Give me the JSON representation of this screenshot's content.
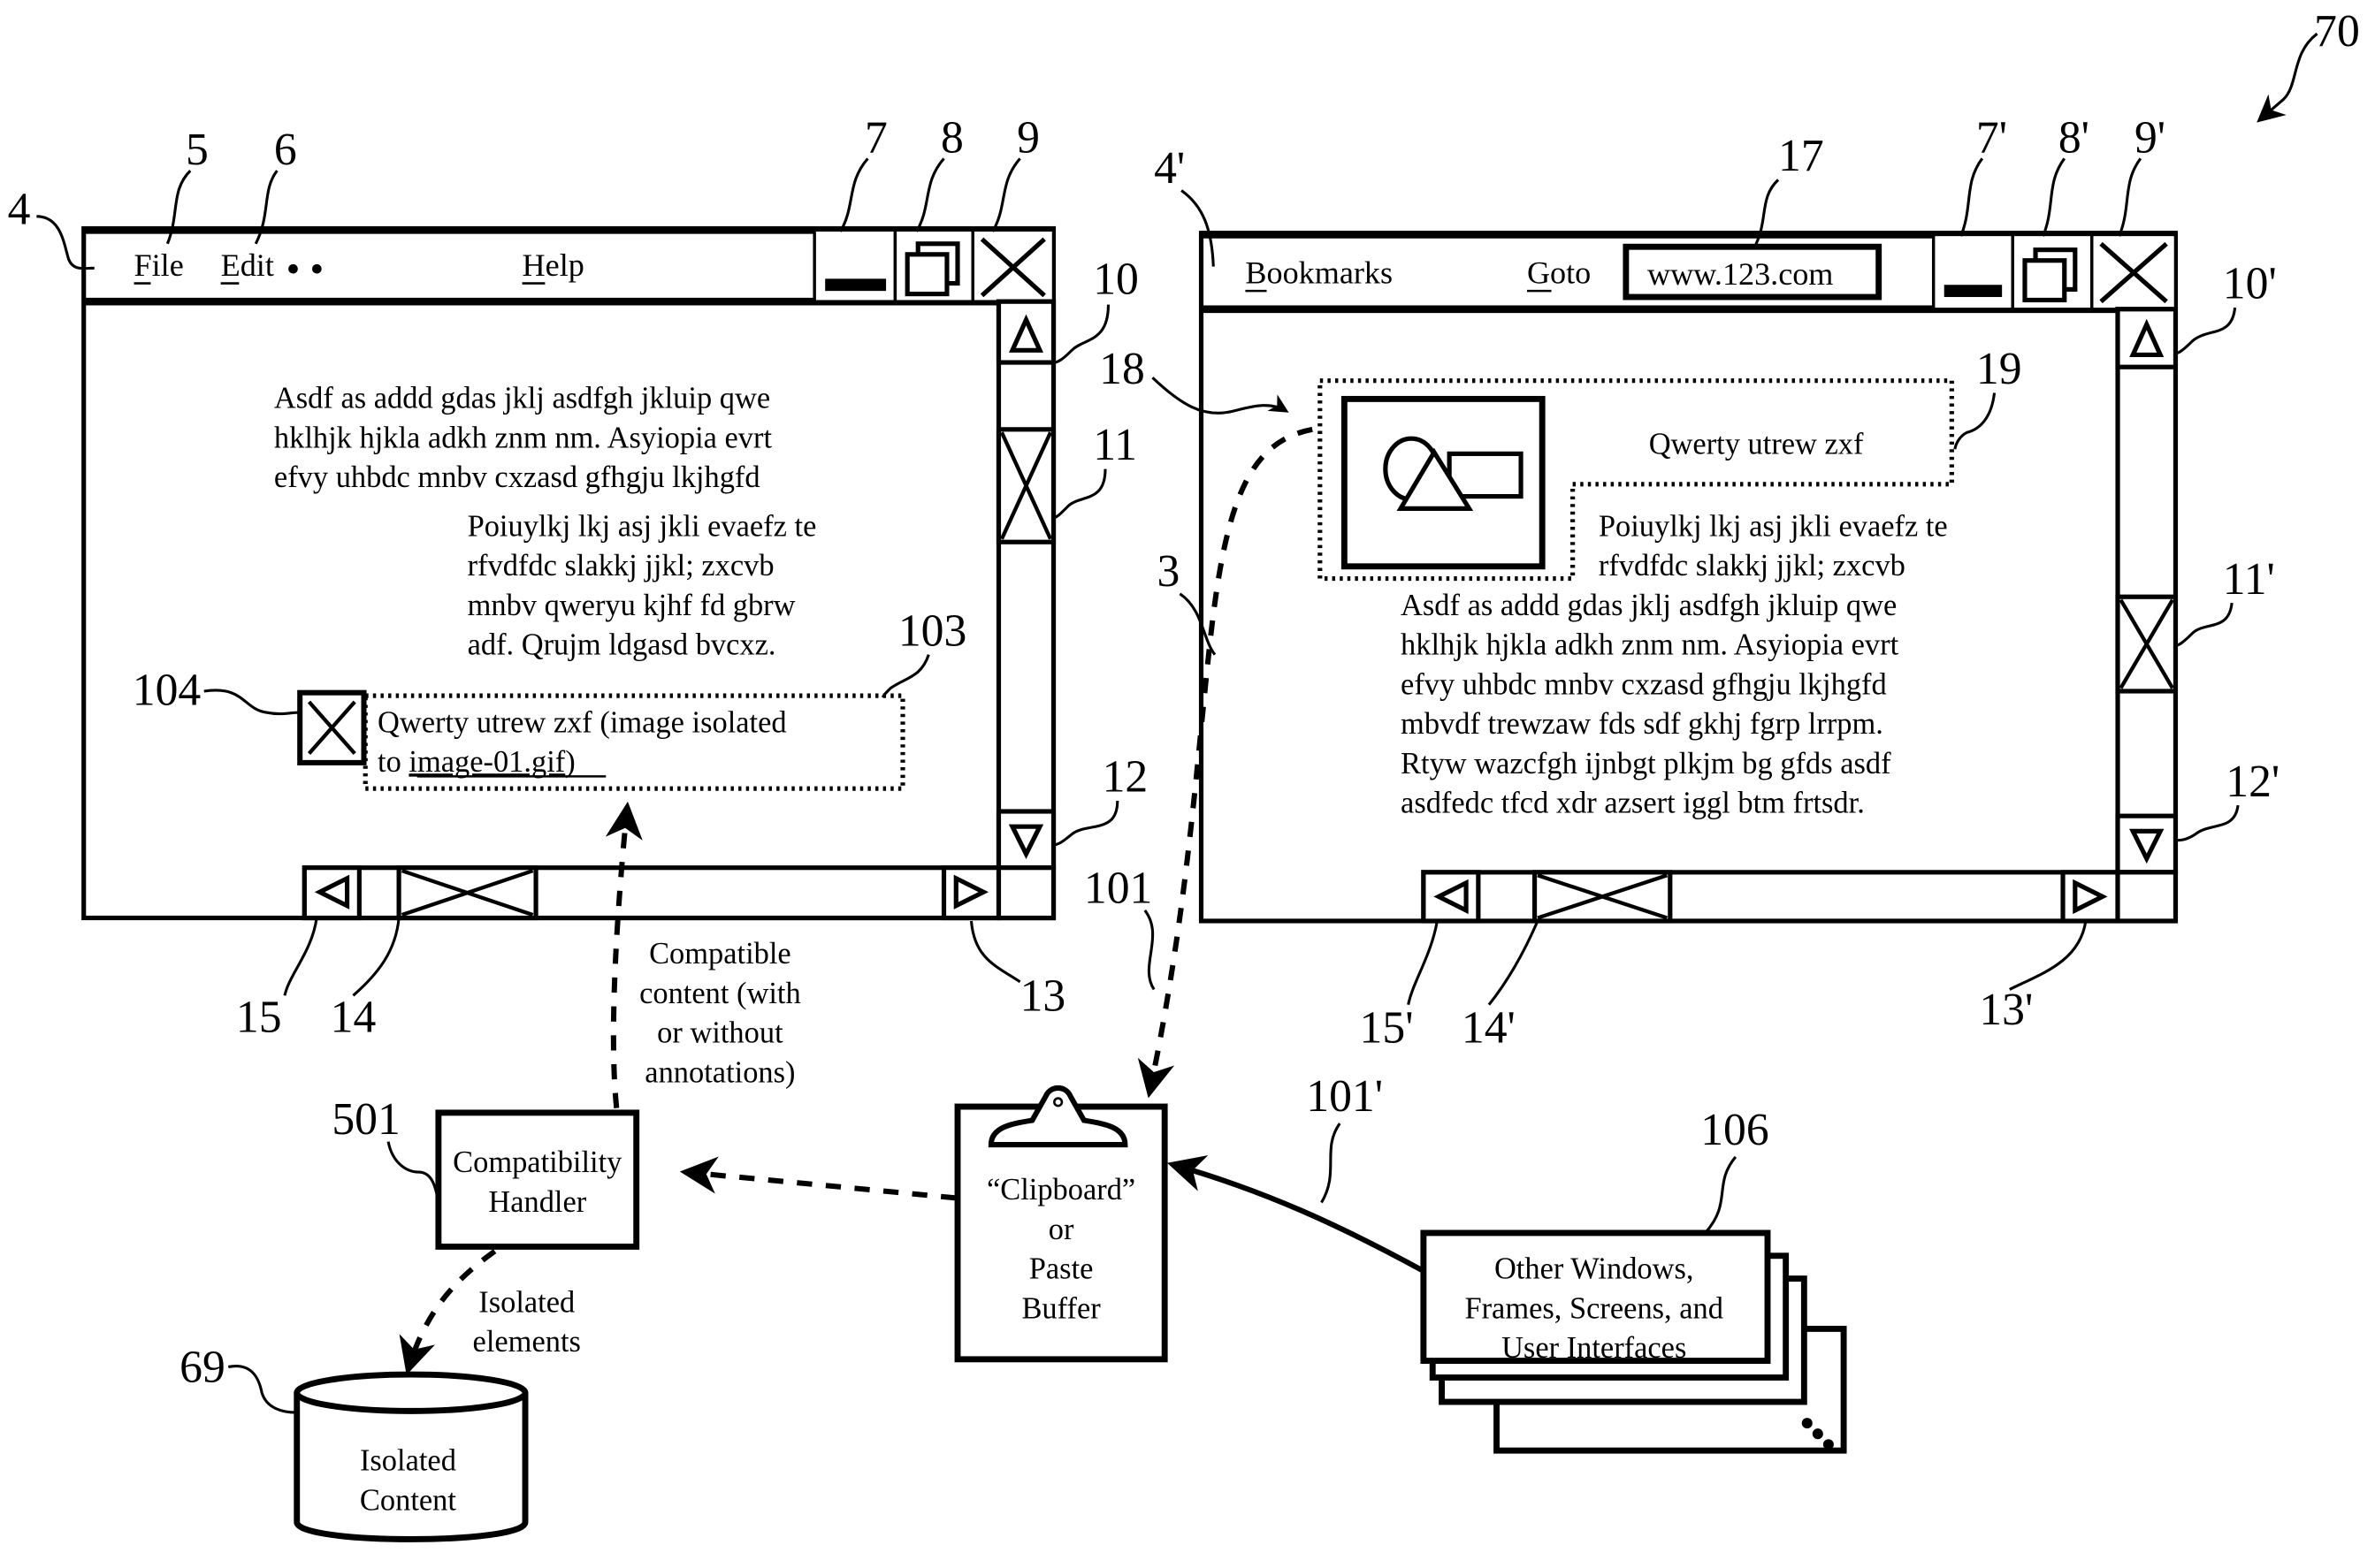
{
  "figure_ref": "70",
  "left_window": {
    "ref": "4",
    "menu": {
      "file": "File",
      "edit": "Edit",
      "ellipsis": "• •",
      "help": "Help"
    },
    "menu_refs": {
      "file": "5",
      "edit": "6"
    },
    "controls": {
      "minimize_ref": "7",
      "restore_ref": "8",
      "close_ref": "9"
    },
    "scroll_refs": {
      "up": "10",
      "thumb_v": "11",
      "down": "12",
      "right": "13",
      "thumb_h": "14",
      "left": "15"
    },
    "paragraph1": [
      "Asdf as addd gdas jklj asdfgh jkluip qwe",
      "hklhjk hjkla adkh znm nm.  Asyiopia evrt",
      "efvy uhbdc mnbv cxzasd gfhgju lkjhgfd"
    ],
    "paragraph2": [
      "Poiuylkj lkj asj jkli evaefz te",
      "rfvdfdc slakkj jjkl; zxcvb",
      "mnbv qweryu kjhf fd gbrw",
      "adf.  Qrujm ldgasd bvcxz."
    ],
    "placeholder": {
      "ref_icon": "104",
      "ref_box": "103",
      "line1": "Qwerty utrew zxf (image isolated",
      "line2_prefix": "to ",
      "line2_link": "image-01.gif",
      "line2_suffix": ")"
    }
  },
  "right_window": {
    "ref": "4'",
    "menu": {
      "bookmarks": "Bookmarks",
      "goto": "Goto",
      "url": "www.123.com"
    },
    "url_ref": "17",
    "controls": {
      "minimize_ref": "7'",
      "restore_ref": "8'",
      "close_ref": "9'"
    },
    "scroll_refs": {
      "up": "10'",
      "thumb_v": "11'",
      "down": "12'",
      "right": "13'",
      "thumb_h": "14'",
      "left": "15'"
    },
    "selection_ref": "18",
    "caption_ref": "19",
    "caption": "Qwerty utrew zxf",
    "paragraph2": [
      "Poiuylkj lkj asj jkli evaefz te",
      "rfvdfdc slakkj jjkl; zxcvb"
    ],
    "paragraph1": [
      "Asdf as addd gdas jklj asdfgh jkluip qwe",
      "hklhjk hjkla adkh znm nm.  Asyiopia evrt",
      "efvy uhbdc mnbv cxzasd gfhgju lkjhgfd",
      "mbvdf trewzaw fds sdf gkhj fgrp lrrpm.",
      "Rtyw wazcfgh ijnbgt plkjm bg gfds asdf",
      "asdfedc tfcd xdr azsert iggl btm frtsdr."
    ]
  },
  "flows": {
    "copy_ref": "3",
    "paste_ref": "101",
    "other_ref": "101'",
    "compatible_label": [
      "Compatible",
      "content (with",
      "or without",
      "annotations)"
    ],
    "isolated_label": [
      "Isolated",
      "elements"
    ]
  },
  "compatibility_handler": {
    "ref": "501",
    "lines": [
      "Compatibility",
      "Handler"
    ]
  },
  "clipboard": {
    "lines": [
      "“Clipboard”",
      "or",
      "Paste",
      "Buffer"
    ]
  },
  "other_windows": {
    "ref": "106",
    "lines": [
      "Other Windows,",
      "Frames, Screens, and",
      "User Interfaces"
    ]
  },
  "isolated_content": {
    "ref": "69",
    "lines": [
      "Isolated",
      "Content"
    ]
  }
}
